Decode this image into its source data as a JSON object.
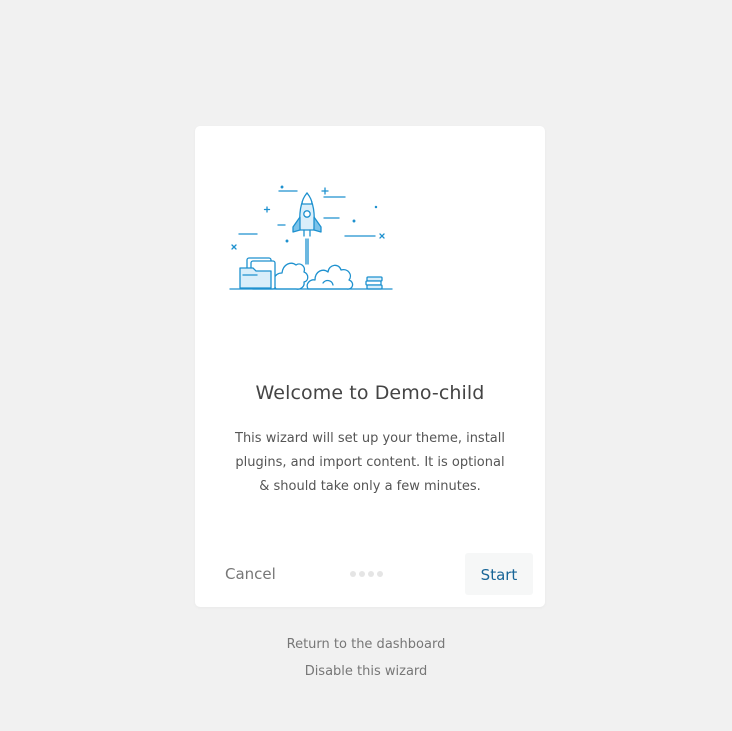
{
  "wizard": {
    "title": "Welcome to Demo-child",
    "description": "This wizard will set up your theme, install plugins, and import content. It is optional & should take only a few minutes.",
    "cancel_label": "Cancel",
    "start_label": "Start",
    "progress_steps": 4
  },
  "links": {
    "return_dashboard": "Return to the dashboard",
    "disable_wizard": "Disable this wizard"
  },
  "colors": {
    "accent": "#186597",
    "illustration_blue": "#1e91cf",
    "illustration_light": "#d9eefa",
    "background": "#f1f1f1"
  },
  "icons": {
    "illustration": "rocket-launch-illustration"
  }
}
